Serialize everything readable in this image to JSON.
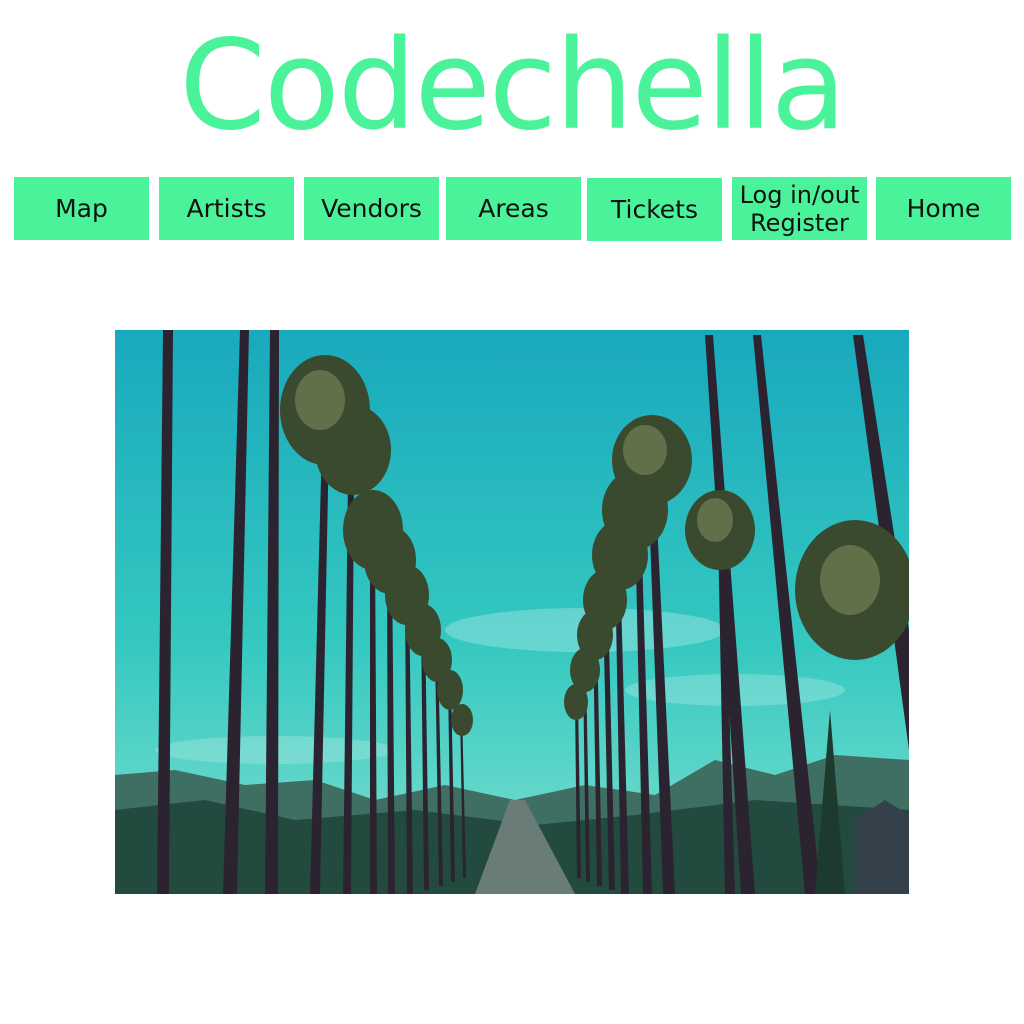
{
  "site": {
    "title": "Codechella",
    "accent_color": "#4af39a"
  },
  "nav": {
    "items": [
      {
        "label": "Map"
      },
      {
        "label": "Artists"
      },
      {
        "label": "Vendors"
      },
      {
        "label": "Areas"
      },
      {
        "label": "Tickets"
      },
      {
        "label": "Log in/out\nRegister"
      },
      {
        "label": "Home"
      }
    ]
  },
  "hero": {
    "subject": "palm-tree-lined street under blue sky",
    "sky_color": "#2ec4c0"
  }
}
